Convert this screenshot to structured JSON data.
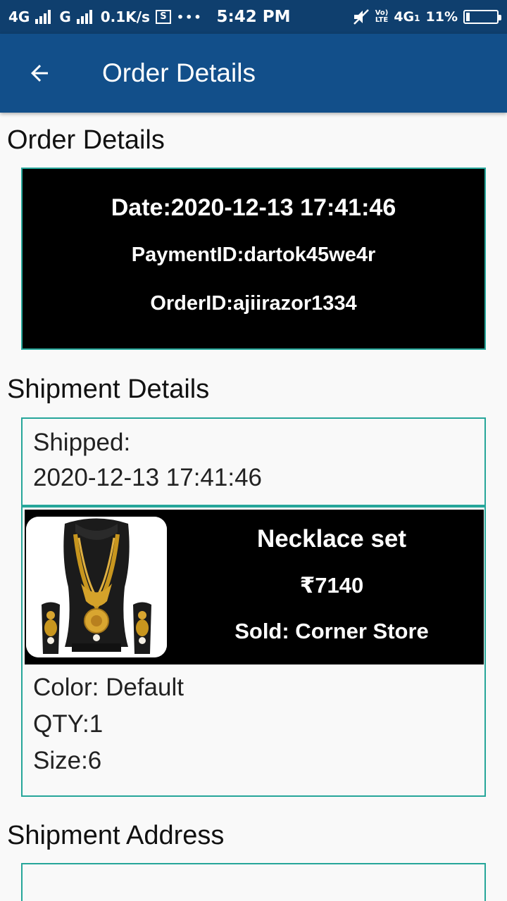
{
  "status_bar": {
    "net1": "4G",
    "net2": "G",
    "speed": "0.1K/s",
    "s_icon": "S",
    "dots": "•••",
    "time": "5:42 PM",
    "volte_top": "Vo)",
    "volte_bottom": "LTE",
    "net3": "4G",
    "net3_sub": "1",
    "battery": "11%",
    "battery_level": 0.11
  },
  "app_bar": {
    "title": "Order Details",
    "back_icon": "arrow-back-icon"
  },
  "order_section": {
    "title": "Order Details",
    "date": "Date:2020-12-13 17:41:46",
    "payment_id": "PaymentID:dartok45we4r",
    "order_id": "OrderID:ajiirazor1334"
  },
  "shipment_section": {
    "title": "Shipment Details",
    "status_label": "Shipped:",
    "status_time": "2020-12-13 17:41:46",
    "item": {
      "name": "Necklace set",
      "price": "₹7140",
      "sold": "Sold: Corner Store",
      "color": "Color: Default",
      "qty": "QTY:1",
      "size": "Size:6"
    }
  },
  "address_section": {
    "title": "Shipment Address"
  },
  "colors": {
    "status_bar": "#0f3f6e",
    "app_bar": "#124f8a",
    "card_border": "#26a69a"
  }
}
